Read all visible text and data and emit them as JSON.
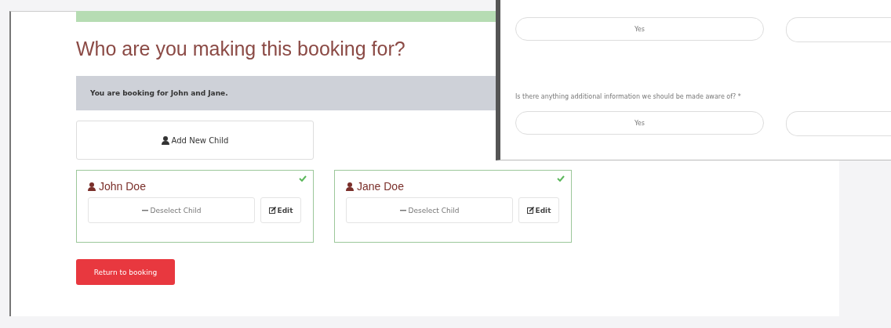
{
  "heading": "Who are you making this booking for?",
  "notice": "You are booking for John and Jane.",
  "add_child": {
    "label": "Add New Child"
  },
  "children": [
    {
      "name": "John Doe",
      "selected": true,
      "deselect_label": "Deselect Child",
      "edit_label": "Edit"
    },
    {
      "name": "Jane Doe",
      "selected": true,
      "deselect_label": "Deselect Child",
      "edit_label": "Edit"
    }
  ],
  "return_button": "Return to booking",
  "overlay": {
    "questions": [
      {
        "answers": [
          "Yes"
        ]
      },
      {
        "text": "Is there anything additional information we should be made aware of? *",
        "answers": [
          "Yes"
        ]
      }
    ]
  }
}
